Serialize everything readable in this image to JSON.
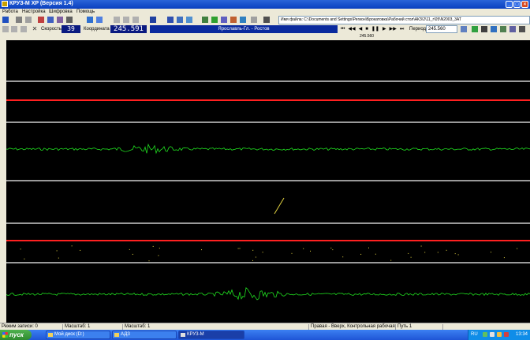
{
  "window": {
    "title": "КРУЗ-М XP (Версия 1.4)",
    "app_icon": "app-icon"
  },
  "menu": {
    "items": [
      "Работа",
      "Настройка",
      "Шифровка",
      "Помощь"
    ]
  },
  "toolbar": {
    "path": "Имя файла: C:\\Documents and Settings\\Регион\\Брокатовка\\Рабочий стол\\АКЗ\\2\\11_г\\05\\N2003_3АТ"
  },
  "controls": {
    "speed_label": "Скорость",
    "speed_value": "39",
    "coord_label": "Координата",
    "coord_value": "245.591",
    "station": "Ярославль-Гл. - Ростов",
    "period_label": "Период",
    "period_value": "245.560",
    "ruler_value": "245.560"
  },
  "status": {
    "items": [
      "Режим записи: 0",
      "Масштаб: 1",
      "Масштаб: 1",
      "Правая - Вверх, Контрольная рабочая",
      "Путь 1"
    ]
  },
  "taskbar": {
    "start": "пуск",
    "tasks": [
      "Мой диск (D:)",
      "АДЗ",
      "КРУЗ-М"
    ],
    "lang": "RU",
    "clock": "13:34"
  },
  "colors": {
    "red_trace": "#ff2020",
    "green_trace": "#20e020",
    "divider": "#9a9a9a"
  }
}
